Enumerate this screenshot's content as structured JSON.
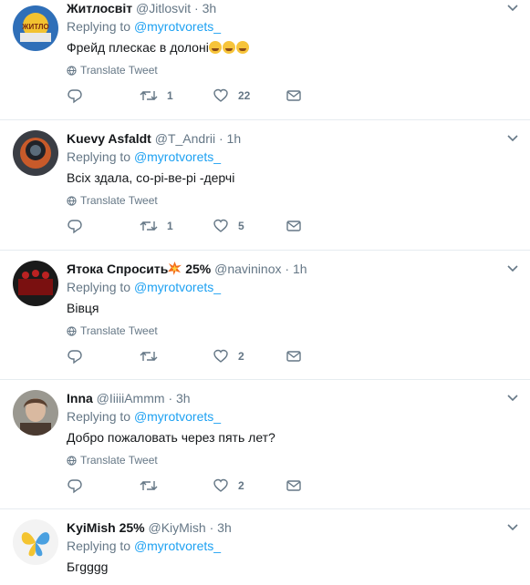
{
  "tweets": [
    {
      "name": "Житлосвіт",
      "handle": "@Jitlosvit",
      "time": "3h",
      "reply_prefix": "Replying to",
      "reply_to": "@myrotvorets_",
      "text": "Фрейд плескає в долоні",
      "emoji_count": 3,
      "translate": "Translate Tweet",
      "retweets": "1",
      "likes": "22"
    },
    {
      "name": "Kuevy Asfaldt",
      "handle": "@T_Andrii",
      "time": "1h",
      "reply_prefix": "Replying to",
      "reply_to": "@myrotvorets_",
      "text": "Всіх здала, со-рі-ве-рі -дерчі",
      "translate": "Translate Tweet",
      "retweets": "1",
      "likes": "5"
    },
    {
      "name": "Ятока Спросить",
      "name_suffix": "25%",
      "handle": "@navininox",
      "time": "1h",
      "reply_prefix": "Replying to",
      "reply_to": "@myrotvorets_",
      "text": "Вівця",
      "translate": "Translate Tweet",
      "retweets": "",
      "likes": "2"
    },
    {
      "name": "Inna",
      "handle": "@IiiiiAmmm",
      "time": "3h",
      "reply_prefix": "Replying to",
      "reply_to": "@myrotvorets_",
      "text": "Добро пожаловать через пять лет?",
      "translate": "Translate Tweet",
      "retweets": "",
      "likes": "2"
    },
    {
      "name": "KyiMish 25%",
      "handle": "@KiyMish",
      "time": "3h",
      "reply_prefix": "Replying to",
      "reply_to": "@myrotvorets_",
      "text": "Бгgggg"
    }
  ],
  "separator": "·",
  "colors": {
    "link": "#1da1f2",
    "muted": "#657786",
    "border": "#e6ecf0"
  },
  "icons": [
    "reply-icon",
    "retweet-icon",
    "like-icon",
    "dm-icon",
    "globe-icon",
    "chevron-down-icon"
  ]
}
